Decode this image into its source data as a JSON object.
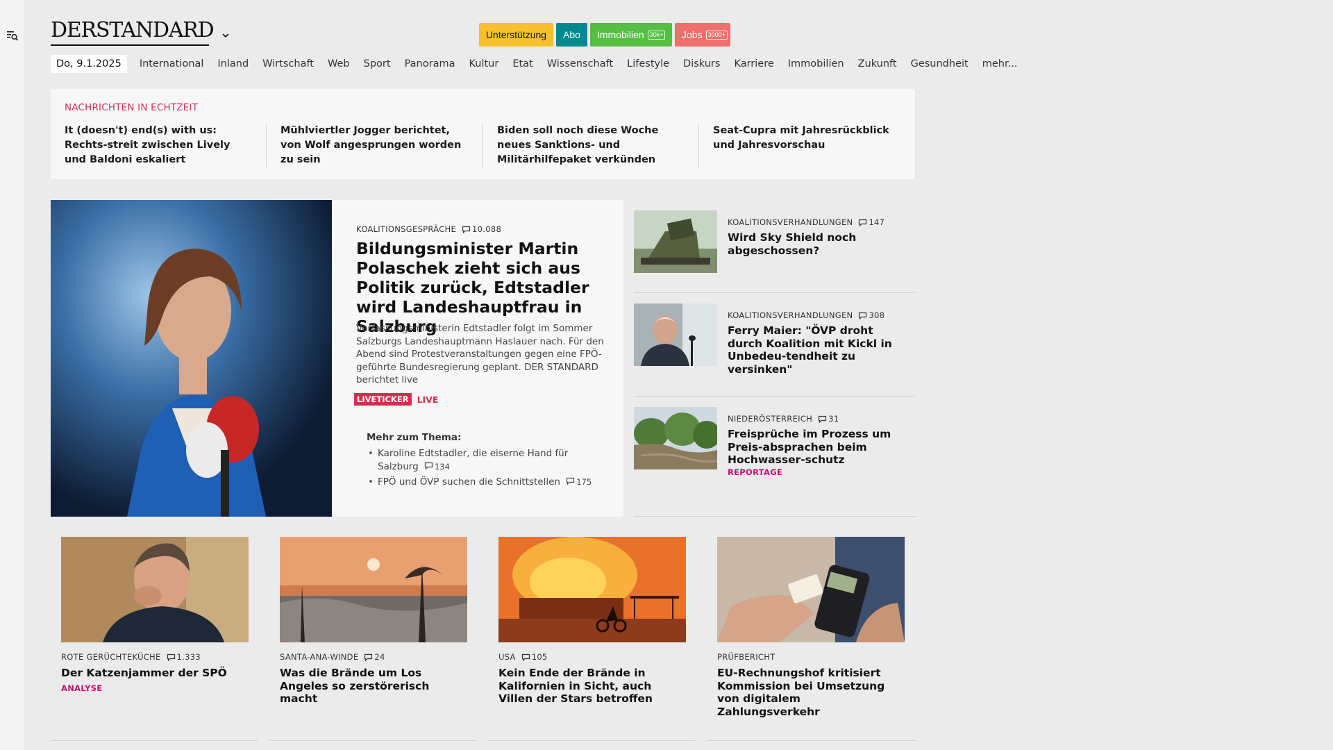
{
  "brand": {
    "logo": "DERSTANDARD"
  },
  "top_buttons": {
    "support": "Unterstützung",
    "abo": "Abo",
    "immobilien": "Immobilien",
    "immobilien_badge": "30k+",
    "jobs": "Jobs",
    "jobs_badge": "3000+"
  },
  "nav": {
    "date": "Do, 9.1.2025",
    "items": [
      "International",
      "Inland",
      "Wirtschaft",
      "Web",
      "Sport",
      "Panorama",
      "Kultur",
      "Etat",
      "Wissenschaft",
      "Lifestyle",
      "Diskurs",
      "Karriere",
      "Immobilien",
      "Zukunft",
      "Gesundheit",
      "mehr..."
    ]
  },
  "ticker": {
    "title": "NACHRICHTEN IN ECHTZEIT",
    "items": [
      "It (doesn't) end(s) with us: Rechts-streit zwischen Lively und Baldoni eskaliert",
      "Mühlviertler Jogger berichtet, von Wolf angesprungen worden zu sein",
      "Biden soll noch diese Woche neues Sanktions- und Militärhilfepaket verkünden",
      "Seat-Cupra mit Jahresrückblick und Jahresvorschau"
    ]
  },
  "lead": {
    "kicker": "KOALITIONSGESPRÄCHE",
    "comments": "10.088",
    "title": "Bildungsminister Martin Polaschek zieht sich aus Politik zurück, Edtstadler wird Landeshauptfrau in Salzburg",
    "teaser": "Verfassungsministerin Edtstadler folgt im Sommer Salzburgs Landeshauptmann Haslauer nach. Für den Abend sind Protestveranstaltungen gegen eine FPÖ-geführte Bundesregierung geplant. DER STANDARD berichtet live",
    "live_badge": "LIVETICKER",
    "live_label": "LIVE",
    "more_title": "Mehr zum Thema:",
    "more": [
      {
        "text": "Karoline Edtstadler, die eiserne Hand für Salzburg",
        "comments": "134"
      },
      {
        "text": "FPÖ und ÖVP suchen die Schnittstellen",
        "comments": "175"
      }
    ]
  },
  "side": [
    {
      "kicker": "KOALITIONSVERHANDLUNGEN",
      "comments": "147",
      "title": "Wird Sky Shield noch abgeschossen?",
      "tag": ""
    },
    {
      "kicker": "KOALITIONSVERHANDLUNGEN",
      "comments": "308",
      "title": "Ferry Maier: \"ÖVP droht durch Koalition mit Kickl in Unbedeu-tendheit zu versinken\"",
      "tag": ""
    },
    {
      "kicker": "NIEDERÖSTERREICH",
      "comments": "31",
      "title": "Freisprüche im Prozess um Preis-absprachen beim Hochwasser-schutz",
      "tag": "REPORTAGE"
    }
  ],
  "grid": [
    {
      "kicker": "ROTE GERÜCHTEKÜCHE",
      "comments": "1.333",
      "title": "Der Katzenjammer der SPÖ",
      "tag": "ANALYSE"
    },
    {
      "kicker": "SANTA-ANA-WINDE",
      "comments": "24",
      "title": "Was die Brände um Los Angeles so zerstörerisch macht",
      "tag": ""
    },
    {
      "kicker": "USA",
      "comments": "105",
      "title": "Kein Ende der Brände in Kalifornien in Sicht, auch Villen der Stars betroffen",
      "tag": ""
    },
    {
      "kicker": "PRÜFBERICHT",
      "comments": "",
      "title": "EU-Rechnungshof kritisiert Kommission bei Umsetzung von digitalem Zahlungsverkehr",
      "tag": ""
    }
  ],
  "colors": {
    "ticker_red": "#d62d5b",
    "tag_magenta": "#c4106f",
    "live_red": "#d62d4e",
    "support_yellow": "#f6c12d",
    "abo_teal": "#008a8e",
    "immo_green": "#56bd45",
    "jobs_red": "#ef6f6c"
  },
  "icons": {
    "menu": "menu-search-icon",
    "edition": "chevron-down-icon",
    "comment": "comment-bubble-icon"
  }
}
